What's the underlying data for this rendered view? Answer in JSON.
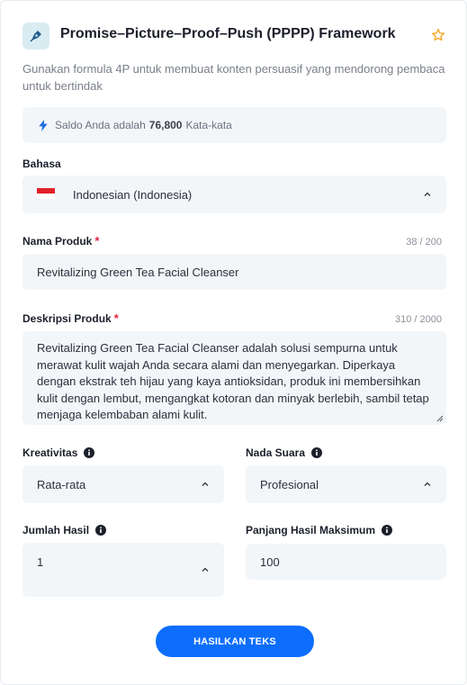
{
  "header": {
    "title": "Promise–Picture–Proof–Push (PPPP) Framework",
    "subtitle": "Gunakan formula 4P untuk membuat konten persuasif yang mendorong pembaca untuk bertindak"
  },
  "balance": {
    "prefix": "Saldo Anda adalah",
    "amount": "76,800",
    "suffix": "Kata-kata"
  },
  "language": {
    "label": "Bahasa",
    "value": "Indonesian (Indonesia)"
  },
  "product_name": {
    "label": "Nama Produk",
    "required_mark": "*",
    "counter": "38 / 200",
    "value": "Revitalizing Green Tea Facial Cleanser"
  },
  "product_description": {
    "label": "Deskripsi Produk",
    "required_mark": "*",
    "counter": "310 / 2000",
    "value": "Revitalizing Green Tea Facial Cleanser adalah solusi sempurna untuk merawat kulit wajah Anda secara alami dan menyegarkan. Diperkaya dengan ekstrak teh hijau yang kaya antioksidan, produk ini membersihkan kulit dengan lembut, mengangkat kotoran dan minyak berlebih, sambil tetap menjaga kelembaban alami kulit."
  },
  "creativity": {
    "label": "Kreativitas",
    "value": "Rata-rata"
  },
  "tone": {
    "label": "Nada Suara",
    "value": "Profesional"
  },
  "result_count": {
    "label": "Jumlah Hasil",
    "value": "1"
  },
  "max_length": {
    "label": "Panjang Hasil Maksimum",
    "value": "100"
  },
  "generate_button": {
    "label": "HASILKAN TEKS"
  },
  "colors": {
    "accent": "#0d6efd",
    "required": "#e0243a",
    "field_bg": "#f3f6f9",
    "star": "#f5a623"
  },
  "icons": [
    "pen-nib-icon",
    "star-icon",
    "lightning-icon",
    "info-icon",
    "chevron-up-icon",
    "indonesia-flag-icon"
  ]
}
